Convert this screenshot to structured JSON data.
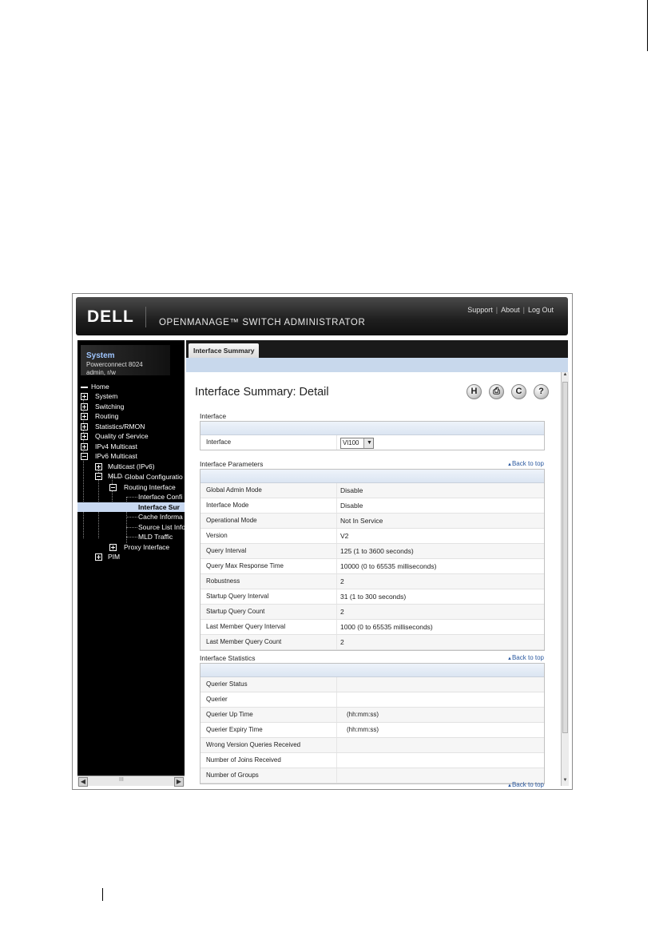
{
  "header": {
    "logo": "DELL",
    "app_title": "OPENMANAGE™ SWITCH ADMINISTRATOR",
    "links": [
      "Support",
      "About",
      "Log Out"
    ]
  },
  "sidebar": {
    "system_title": "System",
    "model": "Powerconnect 8024",
    "user": "admin, r/w",
    "tree": [
      {
        "label": "Home"
      },
      {
        "label": "System"
      },
      {
        "label": "Switching"
      },
      {
        "label": "Routing"
      },
      {
        "label": "Statistics/RMON"
      },
      {
        "label": "Quality of Service"
      },
      {
        "label": "IPv4 Multicast"
      },
      {
        "label": "IPv6 Multicast"
      },
      {
        "label": "Multicast (IPv6)"
      },
      {
        "label": "MLD"
      },
      {
        "label": "Global Configuratio"
      },
      {
        "label": "Routing Interface"
      },
      {
        "label": "Interface Confi"
      },
      {
        "label": "Interface Sur"
      },
      {
        "label": "Cache Informa"
      },
      {
        "label": "Source List Info"
      },
      {
        "label": "MLD Traffic"
      },
      {
        "label": "Proxy Interface"
      },
      {
        "label": "PIM"
      }
    ],
    "scroll_mid": "III"
  },
  "content": {
    "tab": "Interface Summary",
    "page_title": "Interface Summary: Detail",
    "icons": [
      "save-icon",
      "print-icon",
      "refresh-icon",
      "help-icon"
    ],
    "icon_glyphs": [
      "H",
      "⎙",
      "C",
      "?"
    ],
    "back_to_top": "Back to top",
    "interface_section": {
      "title": "Interface",
      "label": "Interface",
      "selected": "Vl100"
    },
    "params_section": {
      "title": "Interface Parameters",
      "rows": [
        {
          "label": "Global Admin Mode",
          "value": "Disable"
        },
        {
          "label": "Interface Mode",
          "value": "Disable"
        },
        {
          "label": "Operational Mode",
          "value": "Not In Service"
        },
        {
          "label": "Version",
          "value": "V2"
        },
        {
          "label": "Query Interval",
          "value": "125  (1 to 3600 seconds)"
        },
        {
          "label": "Query Max Response Time",
          "value": "10000  (0 to 65535 milliseconds)"
        },
        {
          "label": "Robustness",
          "value": "2"
        },
        {
          "label": "Startup Query Interval",
          "value": "31  (1 to 300 seconds)"
        },
        {
          "label": "Startup Query Count",
          "value": "2"
        },
        {
          "label": "Last Member Query Interval",
          "value": "1000  (0 to 65535 milliseconds)"
        },
        {
          "label": "Last Member Query Count",
          "value": "2"
        }
      ]
    },
    "stats_section": {
      "title": "Interface Statistics",
      "rows": [
        {
          "label": "Querier Status",
          "value": ""
        },
        {
          "label": "Querier",
          "value": ""
        },
        {
          "label": "Querier Up Time",
          "value": "(hh:mm:ss)"
        },
        {
          "label": "Querier Expiry Time",
          "value": "(hh:mm:ss)"
        },
        {
          "label": "Wrong Version Queries Received",
          "value": ""
        },
        {
          "label": "Number of Joins Received",
          "value": ""
        },
        {
          "label": "Number of Groups",
          "value": ""
        }
      ]
    }
  }
}
